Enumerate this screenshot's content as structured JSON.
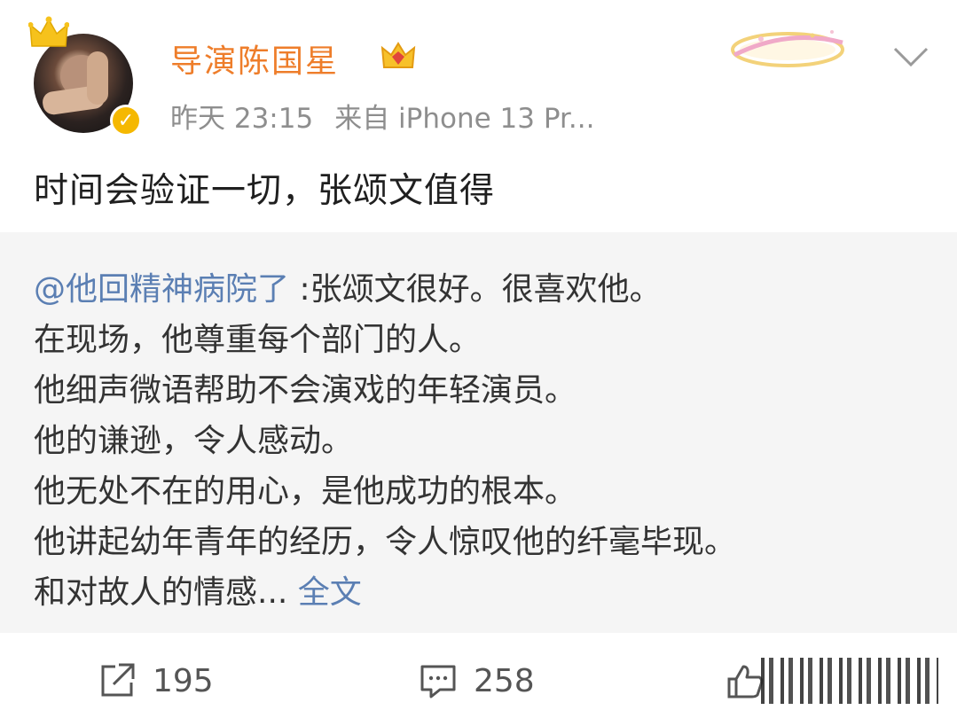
{
  "post": {
    "author": "导演陈国星",
    "time": "昨天 23:15",
    "source": "来自 iPhone 13 Pr...",
    "text": "时间会验证一切，张颂文值得"
  },
  "repost": {
    "mention": "@他回精神病院了",
    "first_line_rest": " :张颂文很好。很喜欢他。",
    "lines": [
      "在现场，他尊重每个部门的人。",
      "他细声微语帮助不会演戏的年轻演员。",
      "他的谦逊，令人感动。",
      "他无处不在的用心，是他成功的根本。",
      "他讲起幼年青年的经历，令人惊叹他的纤毫毕现。"
    ],
    "last_line": "和对故人的情感...",
    "full_text_link": "全文"
  },
  "actions": {
    "repost_count": "195",
    "comment_count": "258"
  },
  "colors": {
    "username": "#ee7d2a",
    "link": "#5b7fb3",
    "verified": "#f5b800"
  }
}
